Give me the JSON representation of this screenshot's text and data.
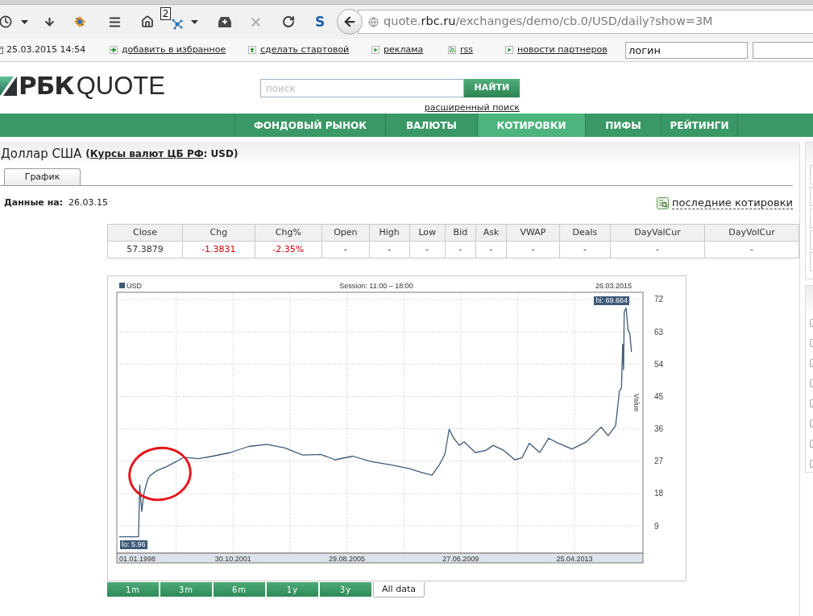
{
  "browser": {
    "tab_badge": "2",
    "addon_letter": "S",
    "url": {
      "subdomain": "quote.",
      "domain": "rbc.ru",
      "path": "/exchanges/demo/cb.0/USD/daily?show=3M"
    }
  },
  "bookmarks_bar": {
    "datetime": "25.03.2015 14:54",
    "links": [
      {
        "label": "добавить в избранное",
        "kind": "plus"
      },
      {
        "label": "сделать стартовой",
        "kind": "home"
      },
      {
        "label": "реклама",
        "kind": "arrow"
      },
      {
        "label": "rss",
        "kind": "rss"
      },
      {
        "label": "новости партнеров",
        "kind": "arrow"
      }
    ],
    "login": {
      "value": "логин"
    }
  },
  "header": {
    "logo": {
      "brand": "РБК",
      "product": "QUOTE"
    },
    "search": {
      "placeholder": "поиск",
      "button": "НАЙТИ",
      "advanced_link": "расширенный поиск"
    }
  },
  "nav": [
    {
      "label": "ФОНДОВЫЙ РЫНОК",
      "selected": false
    },
    {
      "label": "ВАЛЮТЫ",
      "selected": false
    },
    {
      "label": "КОТИРОВКИ",
      "selected": true
    },
    {
      "label": "ПИФЫ",
      "selected": false
    },
    {
      "label": "РЕЙТИНГИ",
      "selected": false
    }
  ],
  "page": {
    "title": "Доллар США",
    "source": {
      "before": "(",
      "link": "Курсы валют ЦБ РФ",
      "after": ": USD)"
    },
    "tabs": [
      {
        "label": "График",
        "selected": true
      }
    ],
    "data_date": {
      "label": "Данные на:",
      "value": "26.03.15"
    },
    "latest_quotes_link": "последние котировки"
  },
  "quote_table": {
    "columns": [
      "Close",
      "Chg",
      "Chg%",
      "Open",
      "High",
      "Low",
      "Bid",
      "Ask",
      "VWAP",
      "Deals",
      "DayValCur",
      "DayVolCur"
    ],
    "rows": [
      {
        "cells": [
          {
            "text": "57.3879",
            "negative": false
          },
          {
            "text": "-1.3831",
            "negative": true
          },
          {
            "text": "-2.35%",
            "negative": true
          },
          {
            "text": "-",
            "negative": false
          },
          {
            "text": "-",
            "negative": false
          },
          {
            "text": "-",
            "negative": false
          },
          {
            "text": "-",
            "negative": false
          },
          {
            "text": "-",
            "negative": false
          },
          {
            "text": "-",
            "negative": false
          },
          {
            "text": "-",
            "negative": false
          },
          {
            "text": "-",
            "negative": false
          },
          {
            "text": "-",
            "negative": false
          }
        ]
      }
    ]
  },
  "chart": {
    "session": "Session: 11:00 – 18:00",
    "as_of": "26.03.2015",
    "chart_data": [
      {
        "type": "line",
        "ylabel": "Value",
        "legend": "top-left",
        "grid": true,
        "xlim": [
          "1997-12-02",
          "2015-08-15"
        ],
        "ylim": [
          1.4,
          74
        ],
        "xticks": [
          {
            "value": "1998-01-01",
            "label": "01.01.1998"
          },
          {
            "value": "2001-10-30",
            "label": "30.10.2001"
          },
          {
            "value": "2005-08-29",
            "label": "29.08.2005"
          },
          {
            "value": "2009-06-27",
            "label": "27.06.2009"
          },
          {
            "value": "2013-04-25",
            "label": "25.04.2013"
          }
        ],
        "yticks": [
          9,
          18,
          27,
          36,
          45,
          54,
          63,
          72
        ],
        "x": [
          "1998-01-01",
          "1998-08-25",
          "1998-09-09",
          "1998-10-04",
          "1998-11-03",
          "1998-12-17",
          "1999-01-08",
          "1999-04-09",
          "1999-07-27",
          "1999-12-05",
          "2000-03-03",
          "2000-08-29",
          "2001-02-21",
          "2001-09-27",
          "2002-05-08",
          "2002-12-17",
          "2003-07-24",
          "2004-03-03",
          "2004-10-12",
          "2005-04-06",
          "2005-11-10",
          "2006-06-17",
          "2007-03-10",
          "2007-10-12",
          "2008-02-28",
          "2008-07-09",
          "2008-10-05",
          "2008-12-13",
          "2009-02-06",
          "2009-04-02",
          "2009-06-10",
          "2009-08-08",
          "2009-12-25",
          "2010-05-01",
          "2010-07-31",
          "2010-12-10",
          "2011-04-23",
          "2011-07-20",
          "2011-10-19",
          "2012-02-24",
          "2012-06-13",
          "2012-10-05",
          "2013-03-26",
          "2013-09-20",
          "2014-03-18",
          "2014-06-13",
          "2014-09-12",
          "2014-10-30",
          "2014-11-24",
          "2014-12-09",
          "2014-12-19",
          "2014-12-27",
          "2015-01-19",
          "2015-02-13",
          "2015-03-07",
          "2015-03-26"
        ],
        "series": [
          {
            "name": "USD",
            "color": "#3d5a78",
            "values": [
              5.96,
              6.0,
              20.4,
              13.0,
              18.4,
              21.9,
              22.9,
              24.4,
              25.4,
              26.9,
              28.1,
              27.7,
              28.4,
              29.4,
              31.1,
              31.7,
              30.7,
              28.7,
              28.9,
              27.4,
              28.4,
              26.9,
              25.9,
              24.9,
              23.9,
              23.1,
              25.9,
              28.9,
              35.9,
              33.4,
              31.4,
              32.4,
              29.4,
              30.0,
              31.4,
              30.0,
              27.4,
              27.9,
              32.0,
              29.4,
              33.4,
              32.0,
              30.4,
              32.4,
              36.5,
              34.1,
              36.9,
              46.5,
              47.4,
              59.6,
              52.5,
              68.5,
              69.664,
              63.5,
              62.5,
              57.4
            ]
          }
        ],
        "annotations": [
          "hi: 69.664",
          "lo: 5.96"
        ]
      }
    ],
    "annotation_marks": [
      {
        "kind": "ellipse"
      }
    ],
    "ranges": [
      {
        "label": "1m",
        "selected": false
      },
      {
        "label": "3m",
        "selected": false
      },
      {
        "label": "6m",
        "selected": false
      },
      {
        "label": "1y",
        "selected": false
      },
      {
        "label": "3y",
        "selected": false
      },
      {
        "label": "All data",
        "selected": true
      }
    ]
  },
  "sidebar": {
    "panels": [
      {
        "inputs": [
          {
            "kind": "input"
          },
          {
            "kind": "input"
          },
          {
            "kind": "input"
          },
          {
            "kind": "input"
          },
          {
            "kind": "input"
          }
        ]
      },
      {
        "checkboxes": [
          {
            "checked": false
          },
          {
            "checked": false
          },
          {
            "checked": false
          },
          {
            "checked": false
          },
          {
            "checked": false
          },
          {
            "checked": false
          },
          {
            "checked": false
          },
          {
            "checked": false
          }
        ]
      }
    ]
  }
}
